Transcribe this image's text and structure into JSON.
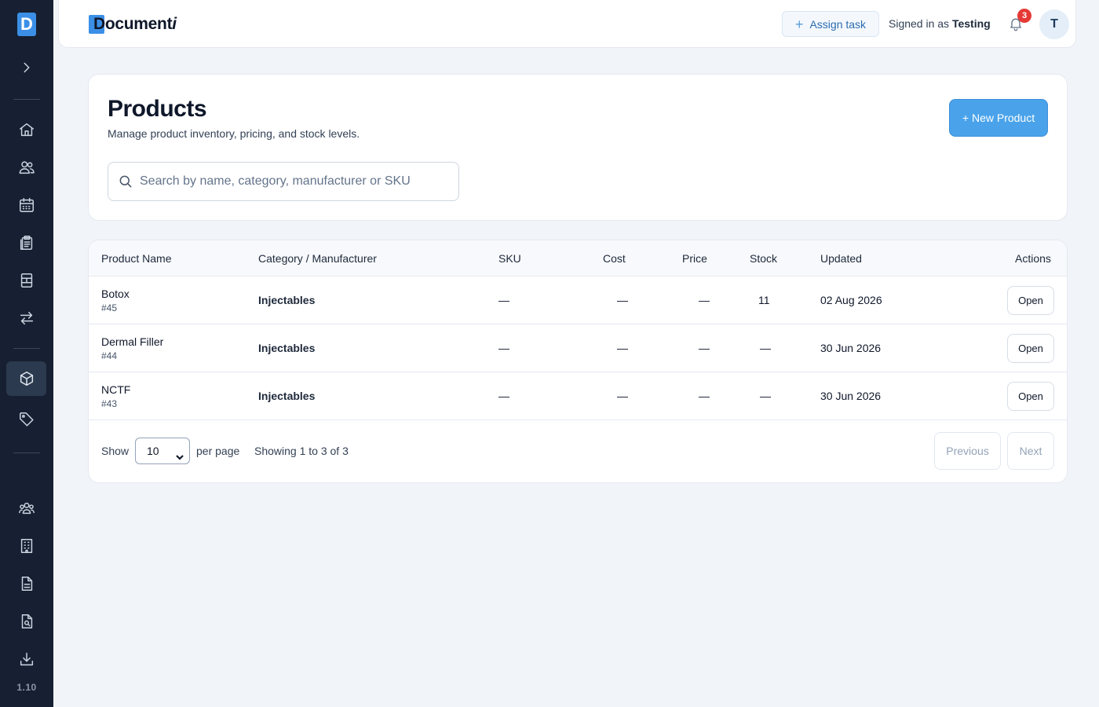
{
  "brand": {
    "name_main": "Document",
    "name_tail": "i"
  },
  "sidebar": {
    "items": [
      {
        "name": "home-icon"
      },
      {
        "name": "users-icon"
      },
      {
        "name": "calendar-icon"
      },
      {
        "name": "clipboard-icon"
      },
      {
        "name": "document-grid-icon"
      },
      {
        "name": "transfer-icon"
      },
      {
        "name": "box-icon",
        "active": true
      },
      {
        "name": "tag-icon"
      },
      {
        "name": "team-icon"
      },
      {
        "name": "building-icon"
      },
      {
        "name": "file-text-icon"
      },
      {
        "name": "file-search-icon"
      },
      {
        "name": "download-icon"
      }
    ],
    "version": "1.10"
  },
  "topbar": {
    "assign_label": "Assign task",
    "signed_prefix": "Signed in as",
    "signed_user": "Testing",
    "notifications_count": "3",
    "avatar_initial": "T"
  },
  "header": {
    "title": "Products",
    "subtitle": "Manage product inventory, pricing, and stock levels.",
    "new_button": "+ New Product",
    "search_placeholder": "Search by name, category, manufacturer or SKU"
  },
  "table": {
    "columns": [
      "Product Name",
      "Category / Manufacturer",
      "SKU",
      "Cost",
      "Price",
      "Stock",
      "Updated",
      "Actions"
    ],
    "rows": [
      {
        "name": "Botox",
        "id": "#45",
        "category": "Injectables",
        "sku": "—",
        "cost": "—",
        "price": "—",
        "stock": "11",
        "updated": "02 Aug 2026",
        "action": "Open"
      },
      {
        "name": "Dermal Filler",
        "id": "#44",
        "category": "Injectables",
        "sku": "—",
        "cost": "—",
        "price": "—",
        "stock": "—",
        "updated": "30 Jun 2026",
        "action": "Open"
      },
      {
        "name": "NCTF",
        "id": "#43",
        "category": "Injectables",
        "sku": "—",
        "cost": "—",
        "price": "—",
        "stock": "—",
        "updated": "30 Jun 2026",
        "action": "Open"
      }
    ]
  },
  "pagination": {
    "show_label": "Show",
    "per_page_value": "10",
    "per_page_label": "per page",
    "summary": "Showing 1 to 3 of 3",
    "previous": "Previous",
    "next": "Next"
  },
  "colors": {
    "sidebar_bg": "#162032",
    "accent": "#4aa3ea",
    "badge": "#e53935"
  }
}
